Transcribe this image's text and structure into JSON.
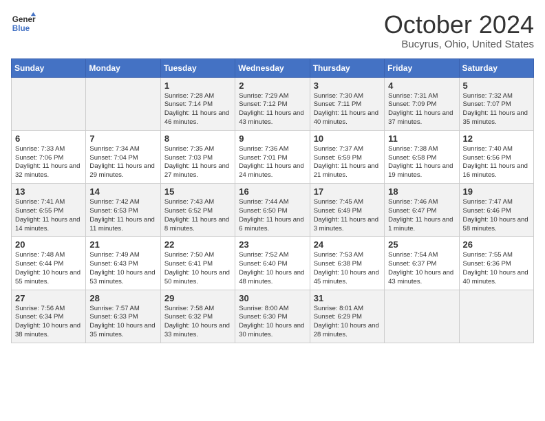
{
  "logo": {
    "line1": "General",
    "line2": "Blue"
  },
  "header": {
    "month": "October 2024",
    "location": "Bucyrus, Ohio, United States"
  },
  "weekdays": [
    "Sunday",
    "Monday",
    "Tuesday",
    "Wednesday",
    "Thursday",
    "Friday",
    "Saturday"
  ],
  "weeks": [
    [
      {
        "day": "",
        "sunrise": "",
        "sunset": "",
        "daylight": ""
      },
      {
        "day": "",
        "sunrise": "",
        "sunset": "",
        "daylight": ""
      },
      {
        "day": "1",
        "sunrise": "Sunrise: 7:28 AM",
        "sunset": "Sunset: 7:14 PM",
        "daylight": "Daylight: 11 hours and 46 minutes."
      },
      {
        "day": "2",
        "sunrise": "Sunrise: 7:29 AM",
        "sunset": "Sunset: 7:12 PM",
        "daylight": "Daylight: 11 hours and 43 minutes."
      },
      {
        "day": "3",
        "sunrise": "Sunrise: 7:30 AM",
        "sunset": "Sunset: 7:11 PM",
        "daylight": "Daylight: 11 hours and 40 minutes."
      },
      {
        "day": "4",
        "sunrise": "Sunrise: 7:31 AM",
        "sunset": "Sunset: 7:09 PM",
        "daylight": "Daylight: 11 hours and 37 minutes."
      },
      {
        "day": "5",
        "sunrise": "Sunrise: 7:32 AM",
        "sunset": "Sunset: 7:07 PM",
        "daylight": "Daylight: 11 hours and 35 minutes."
      }
    ],
    [
      {
        "day": "6",
        "sunrise": "Sunrise: 7:33 AM",
        "sunset": "Sunset: 7:06 PM",
        "daylight": "Daylight: 11 hours and 32 minutes."
      },
      {
        "day": "7",
        "sunrise": "Sunrise: 7:34 AM",
        "sunset": "Sunset: 7:04 PM",
        "daylight": "Daylight: 11 hours and 29 minutes."
      },
      {
        "day": "8",
        "sunrise": "Sunrise: 7:35 AM",
        "sunset": "Sunset: 7:03 PM",
        "daylight": "Daylight: 11 hours and 27 minutes."
      },
      {
        "day": "9",
        "sunrise": "Sunrise: 7:36 AM",
        "sunset": "Sunset: 7:01 PM",
        "daylight": "Daylight: 11 hours and 24 minutes."
      },
      {
        "day": "10",
        "sunrise": "Sunrise: 7:37 AM",
        "sunset": "Sunset: 6:59 PM",
        "daylight": "Daylight: 11 hours and 21 minutes."
      },
      {
        "day": "11",
        "sunrise": "Sunrise: 7:38 AM",
        "sunset": "Sunset: 6:58 PM",
        "daylight": "Daylight: 11 hours and 19 minutes."
      },
      {
        "day": "12",
        "sunrise": "Sunrise: 7:40 AM",
        "sunset": "Sunset: 6:56 PM",
        "daylight": "Daylight: 11 hours and 16 minutes."
      }
    ],
    [
      {
        "day": "13",
        "sunrise": "Sunrise: 7:41 AM",
        "sunset": "Sunset: 6:55 PM",
        "daylight": "Daylight: 11 hours and 14 minutes."
      },
      {
        "day": "14",
        "sunrise": "Sunrise: 7:42 AM",
        "sunset": "Sunset: 6:53 PM",
        "daylight": "Daylight: 11 hours and 11 minutes."
      },
      {
        "day": "15",
        "sunrise": "Sunrise: 7:43 AM",
        "sunset": "Sunset: 6:52 PM",
        "daylight": "Daylight: 11 hours and 8 minutes."
      },
      {
        "day": "16",
        "sunrise": "Sunrise: 7:44 AM",
        "sunset": "Sunset: 6:50 PM",
        "daylight": "Daylight: 11 hours and 6 minutes."
      },
      {
        "day": "17",
        "sunrise": "Sunrise: 7:45 AM",
        "sunset": "Sunset: 6:49 PM",
        "daylight": "Daylight: 11 hours and 3 minutes."
      },
      {
        "day": "18",
        "sunrise": "Sunrise: 7:46 AM",
        "sunset": "Sunset: 6:47 PM",
        "daylight": "Daylight: 11 hours and 1 minute."
      },
      {
        "day": "19",
        "sunrise": "Sunrise: 7:47 AM",
        "sunset": "Sunset: 6:46 PM",
        "daylight": "Daylight: 10 hours and 58 minutes."
      }
    ],
    [
      {
        "day": "20",
        "sunrise": "Sunrise: 7:48 AM",
        "sunset": "Sunset: 6:44 PM",
        "daylight": "Daylight: 10 hours and 55 minutes."
      },
      {
        "day": "21",
        "sunrise": "Sunrise: 7:49 AM",
        "sunset": "Sunset: 6:43 PM",
        "daylight": "Daylight: 10 hours and 53 minutes."
      },
      {
        "day": "22",
        "sunrise": "Sunrise: 7:50 AM",
        "sunset": "Sunset: 6:41 PM",
        "daylight": "Daylight: 10 hours and 50 minutes."
      },
      {
        "day": "23",
        "sunrise": "Sunrise: 7:52 AM",
        "sunset": "Sunset: 6:40 PM",
        "daylight": "Daylight: 10 hours and 48 minutes."
      },
      {
        "day": "24",
        "sunrise": "Sunrise: 7:53 AM",
        "sunset": "Sunset: 6:38 PM",
        "daylight": "Daylight: 10 hours and 45 minutes."
      },
      {
        "day": "25",
        "sunrise": "Sunrise: 7:54 AM",
        "sunset": "Sunset: 6:37 PM",
        "daylight": "Daylight: 10 hours and 43 minutes."
      },
      {
        "day": "26",
        "sunrise": "Sunrise: 7:55 AM",
        "sunset": "Sunset: 6:36 PM",
        "daylight": "Daylight: 10 hours and 40 minutes."
      }
    ],
    [
      {
        "day": "27",
        "sunrise": "Sunrise: 7:56 AM",
        "sunset": "Sunset: 6:34 PM",
        "daylight": "Daylight: 10 hours and 38 minutes."
      },
      {
        "day": "28",
        "sunrise": "Sunrise: 7:57 AM",
        "sunset": "Sunset: 6:33 PM",
        "daylight": "Daylight: 10 hours and 35 minutes."
      },
      {
        "day": "29",
        "sunrise": "Sunrise: 7:58 AM",
        "sunset": "Sunset: 6:32 PM",
        "daylight": "Daylight: 10 hours and 33 minutes."
      },
      {
        "day": "30",
        "sunrise": "Sunrise: 8:00 AM",
        "sunset": "Sunset: 6:30 PM",
        "daylight": "Daylight: 10 hours and 30 minutes."
      },
      {
        "day": "31",
        "sunrise": "Sunrise: 8:01 AM",
        "sunset": "Sunset: 6:29 PM",
        "daylight": "Daylight: 10 hours and 28 minutes."
      },
      {
        "day": "",
        "sunrise": "",
        "sunset": "",
        "daylight": ""
      },
      {
        "day": "",
        "sunrise": "",
        "sunset": "",
        "daylight": ""
      }
    ]
  ]
}
